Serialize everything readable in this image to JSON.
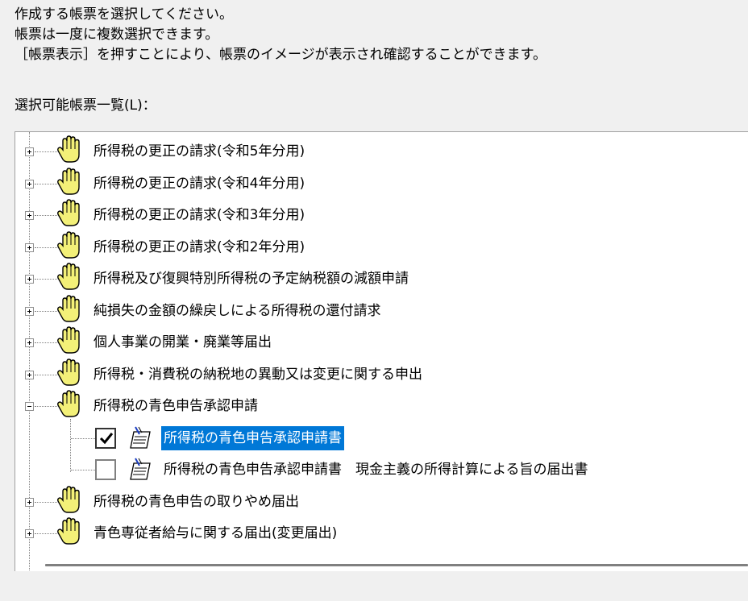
{
  "instructions": {
    "line1": "作成する帳票を選択してください。",
    "line2": "帳票は一度に複数選択できます。",
    "line3": "［帳票表示］を押すことにより、帳票のイメージが表示され確認することができます。"
  },
  "list_label": "選択可能帳票一覧(L)：",
  "tree": {
    "items": [
      {
        "label": "所得税の更正の請求(令和5年分用)",
        "icon": "hand-folder-icon",
        "expanded": false
      },
      {
        "label": "所得税の更正の請求(令和4年分用)",
        "icon": "hand-folder-icon",
        "expanded": false
      },
      {
        "label": "所得税の更正の請求(令和3年分用)",
        "icon": "hand-folder-icon",
        "expanded": false
      },
      {
        "label": "所得税の更正の請求(令和2年分用)",
        "icon": "hand-folder-icon",
        "expanded": false
      },
      {
        "label": "所得税及び復興特別所得税の予定納税額の減額申請",
        "icon": "hand-folder-icon",
        "expanded": false
      },
      {
        "label": "純損失の金額の繰戻しによる所得税の還付請求",
        "icon": "hand-folder-icon",
        "expanded": false
      },
      {
        "label": "個人事業の開業・廃業等届出",
        "icon": "hand-folder-icon",
        "expanded": false
      },
      {
        "label": "所得税・消費税の納税地の異動又は変更に関する申出",
        "icon": "hand-folder-icon",
        "expanded": false
      },
      {
        "label": "所得税の青色申告承認申請",
        "icon": "hand-folder-icon",
        "expanded": true,
        "children": [
          {
            "label": "所得税の青色申告承認申請書",
            "checked": true,
            "selected": true,
            "icon": "document-pen-icon"
          },
          {
            "label": "所得税の青色申告承認申請書　現金主義の所得計算による旨の届出書",
            "checked": false,
            "selected": false,
            "icon": "document-pen-icon"
          }
        ]
      },
      {
        "label": "所得税の青色申告の取りやめ届出",
        "icon": "hand-folder-icon",
        "expanded": false
      },
      {
        "label": "青色専従者給与に関する届出(変更届出)",
        "icon": "hand-folder-icon",
        "expanded": false
      }
    ]
  },
  "colors": {
    "background": "#f0f0f0",
    "tree_background": "#ffffff",
    "selection": "#0078d7",
    "hand_icon": "#f3f078"
  }
}
